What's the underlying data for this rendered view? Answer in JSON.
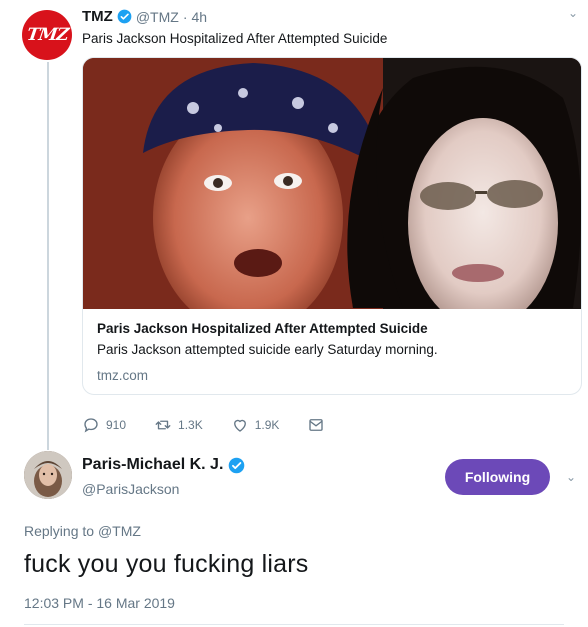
{
  "tweet1": {
    "author_name": "TMZ",
    "avatar_text": "TMZ",
    "handle": "@TMZ",
    "separator": "·",
    "time": "4h",
    "text": "Paris Jackson Hospitalized After Attempted Suicide",
    "card": {
      "title": "Paris Jackson Hospitalized After Attempted Suicide",
      "description": "Paris Jackson attempted suicide early Saturday morning.",
      "domain": "tmz.com"
    },
    "actions": {
      "replies": "910",
      "retweets": "1.3K",
      "likes": "1.9K"
    }
  },
  "tweet2": {
    "author_name": "Paris-Michael K. J.",
    "handle": "@ParisJackson",
    "follow_label": "Following",
    "replying_prefix": "Replying to",
    "replying_to": "@TMZ",
    "text": "fuck you you fucking liars",
    "timestamp": "12:03 PM - 16 Mar 2019"
  },
  "colors": {
    "verified": "#1da1f2",
    "follow_button": "#6c49b8",
    "tmz_red": "#d8121b",
    "muted": "#657786"
  }
}
